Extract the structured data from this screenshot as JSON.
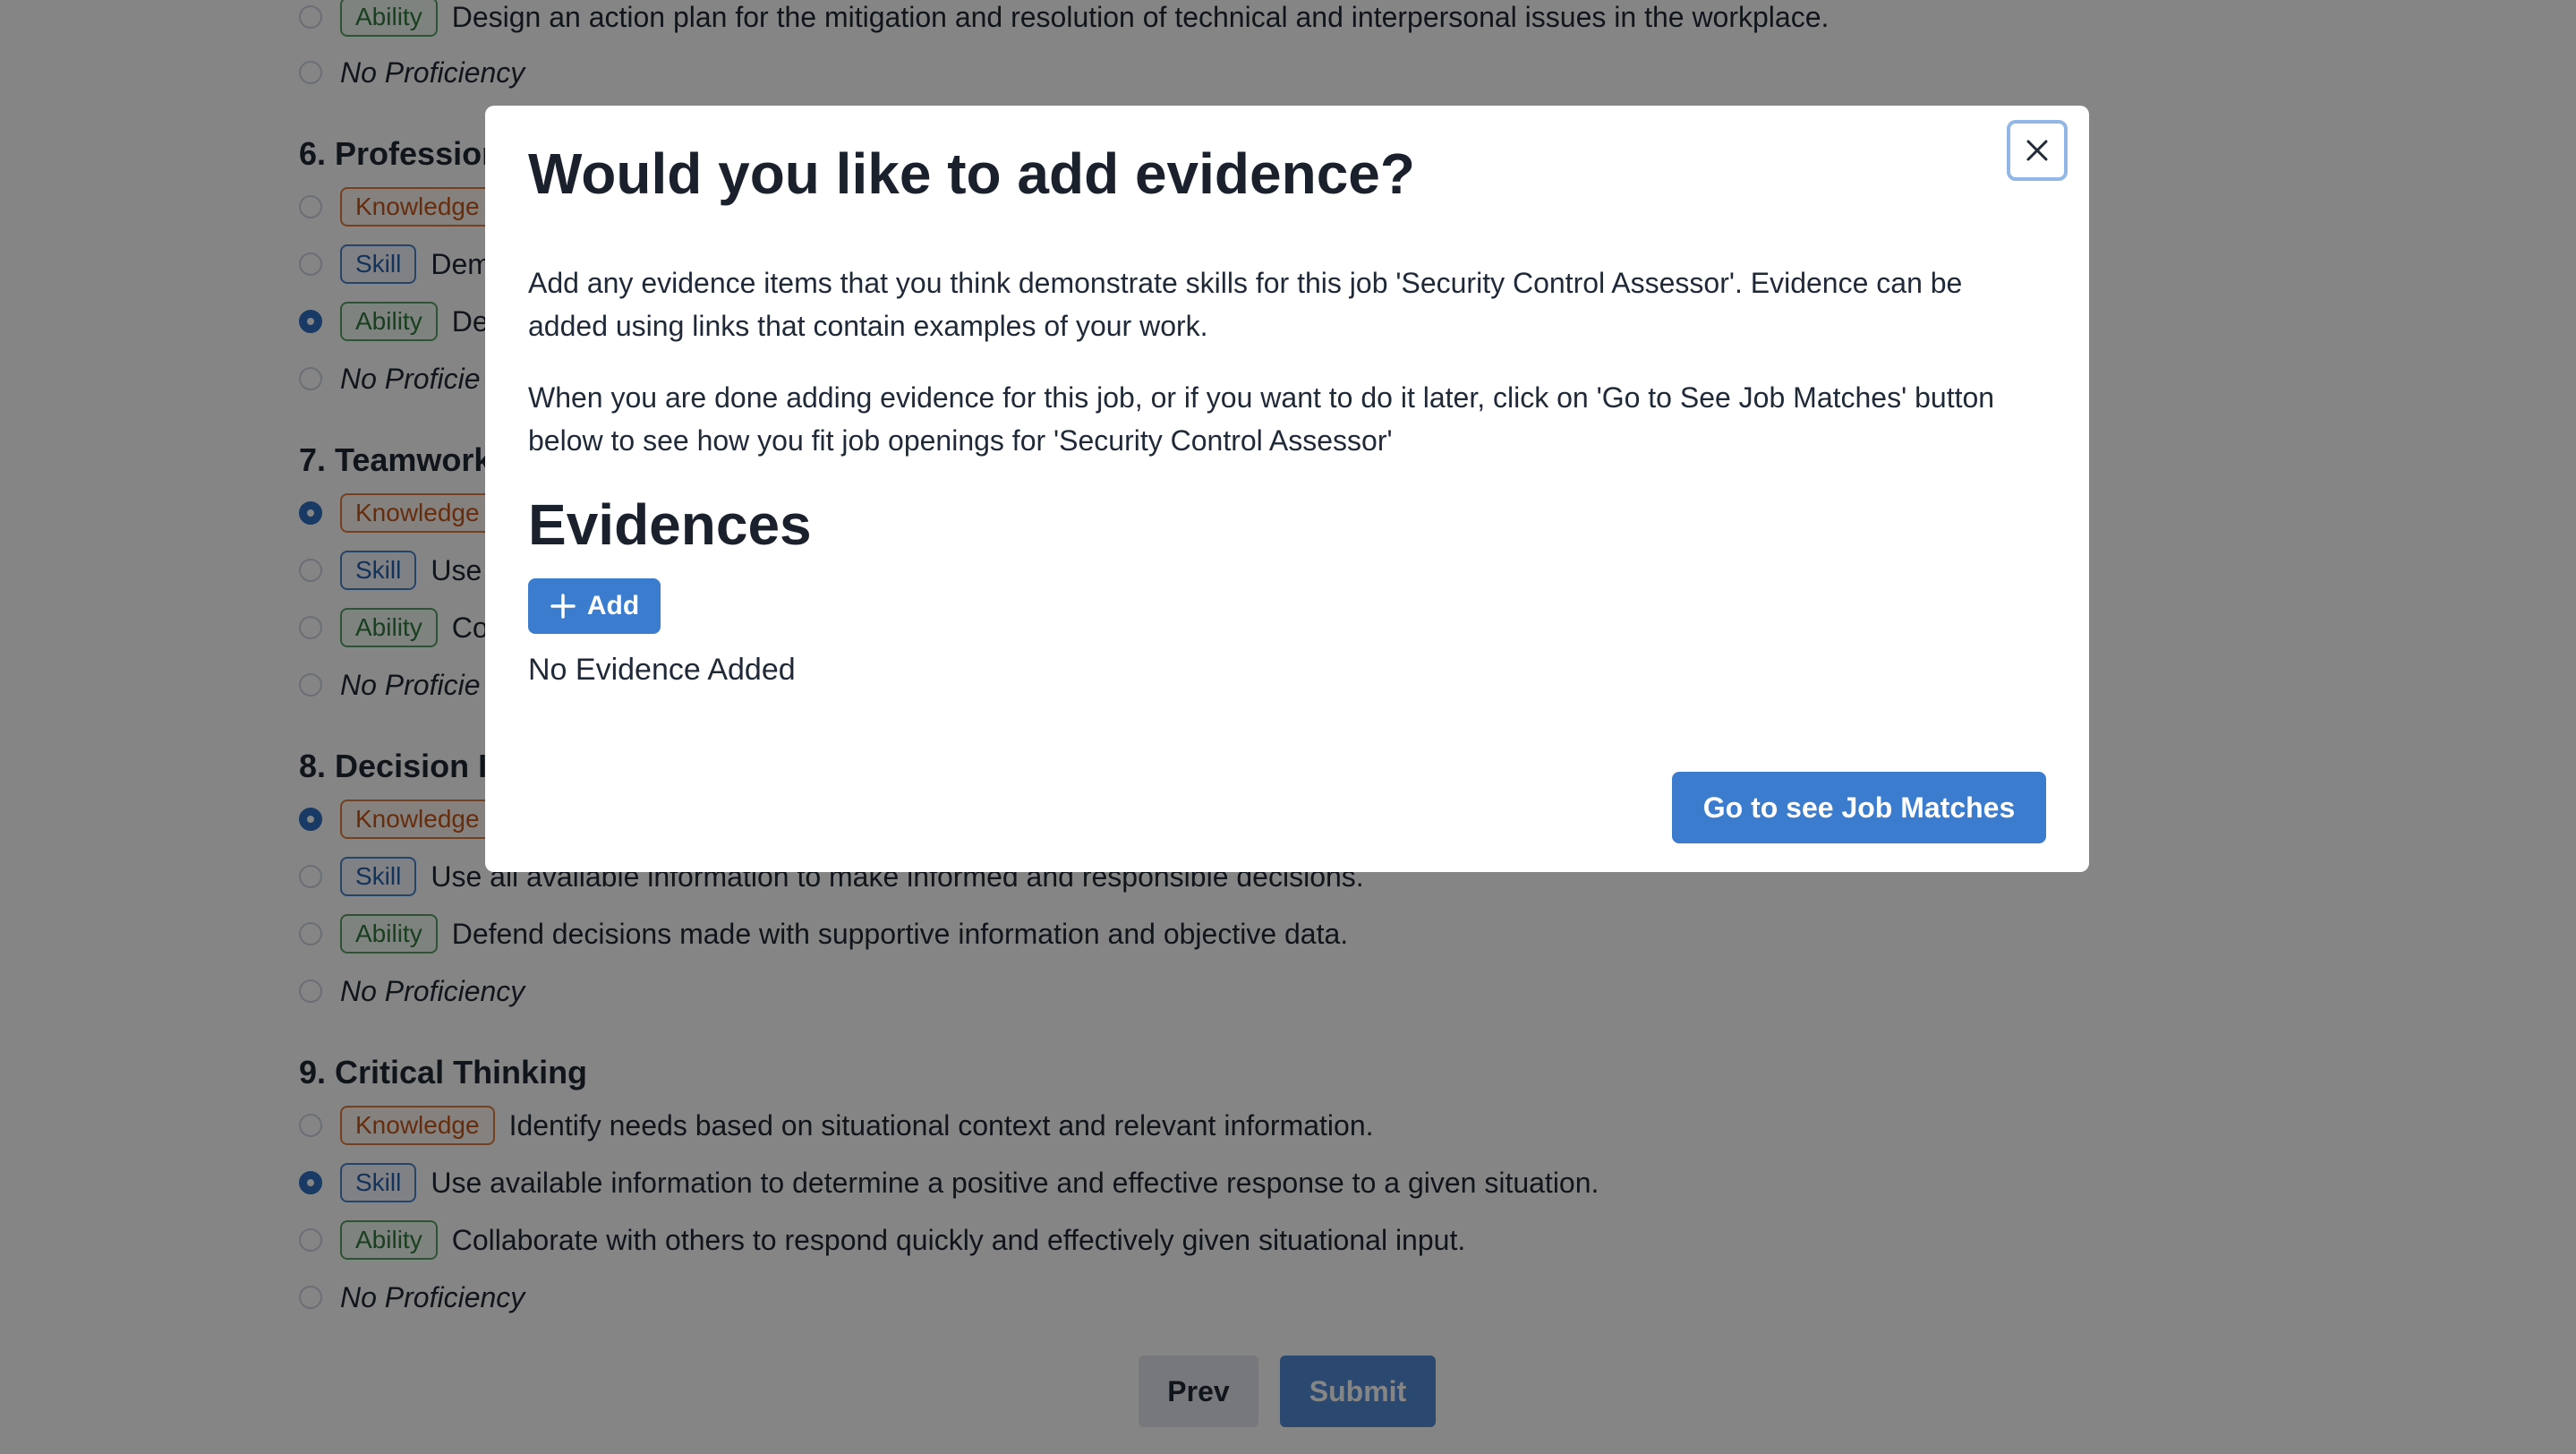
{
  "background": {
    "partial_option": {
      "tag": "Ability",
      "text": "Design an action plan for the mitigation and resolution of technical and interpersonal issues in the workplace."
    },
    "partial_none": "No Proficiency",
    "sections": [
      {
        "title": "6. Profession",
        "options": [
          {
            "tag": "Knowledge",
            "text": "",
            "checked": false
          },
          {
            "tag": "Skill",
            "text": "Dem",
            "checked": false
          },
          {
            "tag": "Ability",
            "text": "De",
            "checked": true
          },
          {
            "tag": "",
            "text": "No Proficie",
            "checked": false
          }
        ]
      },
      {
        "title": "7. Teamwork",
        "options": [
          {
            "tag": "Knowledge",
            "text": "",
            "checked": true
          },
          {
            "tag": "Skill",
            "text": "Use",
            "checked": false
          },
          {
            "tag": "Ability",
            "text": "Co",
            "checked": false
          },
          {
            "tag": "",
            "text": "No Proficie",
            "checked": false
          }
        ]
      },
      {
        "title": "8. Decision I",
        "options": [
          {
            "tag": "Knowledge",
            "text": "",
            "checked": true
          },
          {
            "tag": "Skill",
            "text": "Use all available information to make informed and responsible decisions.",
            "checked": false
          },
          {
            "tag": "Ability",
            "text": "Defend decisions made with supportive information and objective data.",
            "checked": false
          },
          {
            "tag": "",
            "text": "No Proficiency",
            "checked": false
          }
        ]
      },
      {
        "title": "9. Critical Thinking",
        "options": [
          {
            "tag": "Knowledge",
            "text": "Identify needs based on situational context and relevant information.",
            "checked": false
          },
          {
            "tag": "Skill",
            "text": "Use available information to determine a positive and effective response to a given situation.",
            "checked": true
          },
          {
            "tag": "Ability",
            "text": "Collaborate with others to respond quickly and effectively given situational input.",
            "checked": false
          },
          {
            "tag": "",
            "text": "No Proficiency",
            "checked": false
          }
        ]
      }
    ],
    "prev_label": "Prev",
    "submit_label": "Submit"
  },
  "modal": {
    "title": "Would you like to add evidence?",
    "paragraph_1": "Add any evidence items that you think demonstrate skills for this job 'Security Control Assessor'. Evidence can be added using links that contain examples of your work.",
    "paragraph_2": "When you are done adding evidence for this job, or if you want to do it later, click on 'Go to See Job Matches' button below to see how you fit job openings for 'Security Control Assessor'",
    "evidences_heading": "Evidences",
    "add_label": "Add",
    "empty_text": "No Evidence Added",
    "primary_button": "Go to see Job Matches",
    "close_icon": "close-icon",
    "add_icon": "plus-icon"
  },
  "colors": {
    "overlay": "rgba(0,0,0,0.48)",
    "primary": "#3b7ccf",
    "knowledge": "#c2561a",
    "skill": "#2563b0",
    "ability": "#2f7a3d"
  }
}
